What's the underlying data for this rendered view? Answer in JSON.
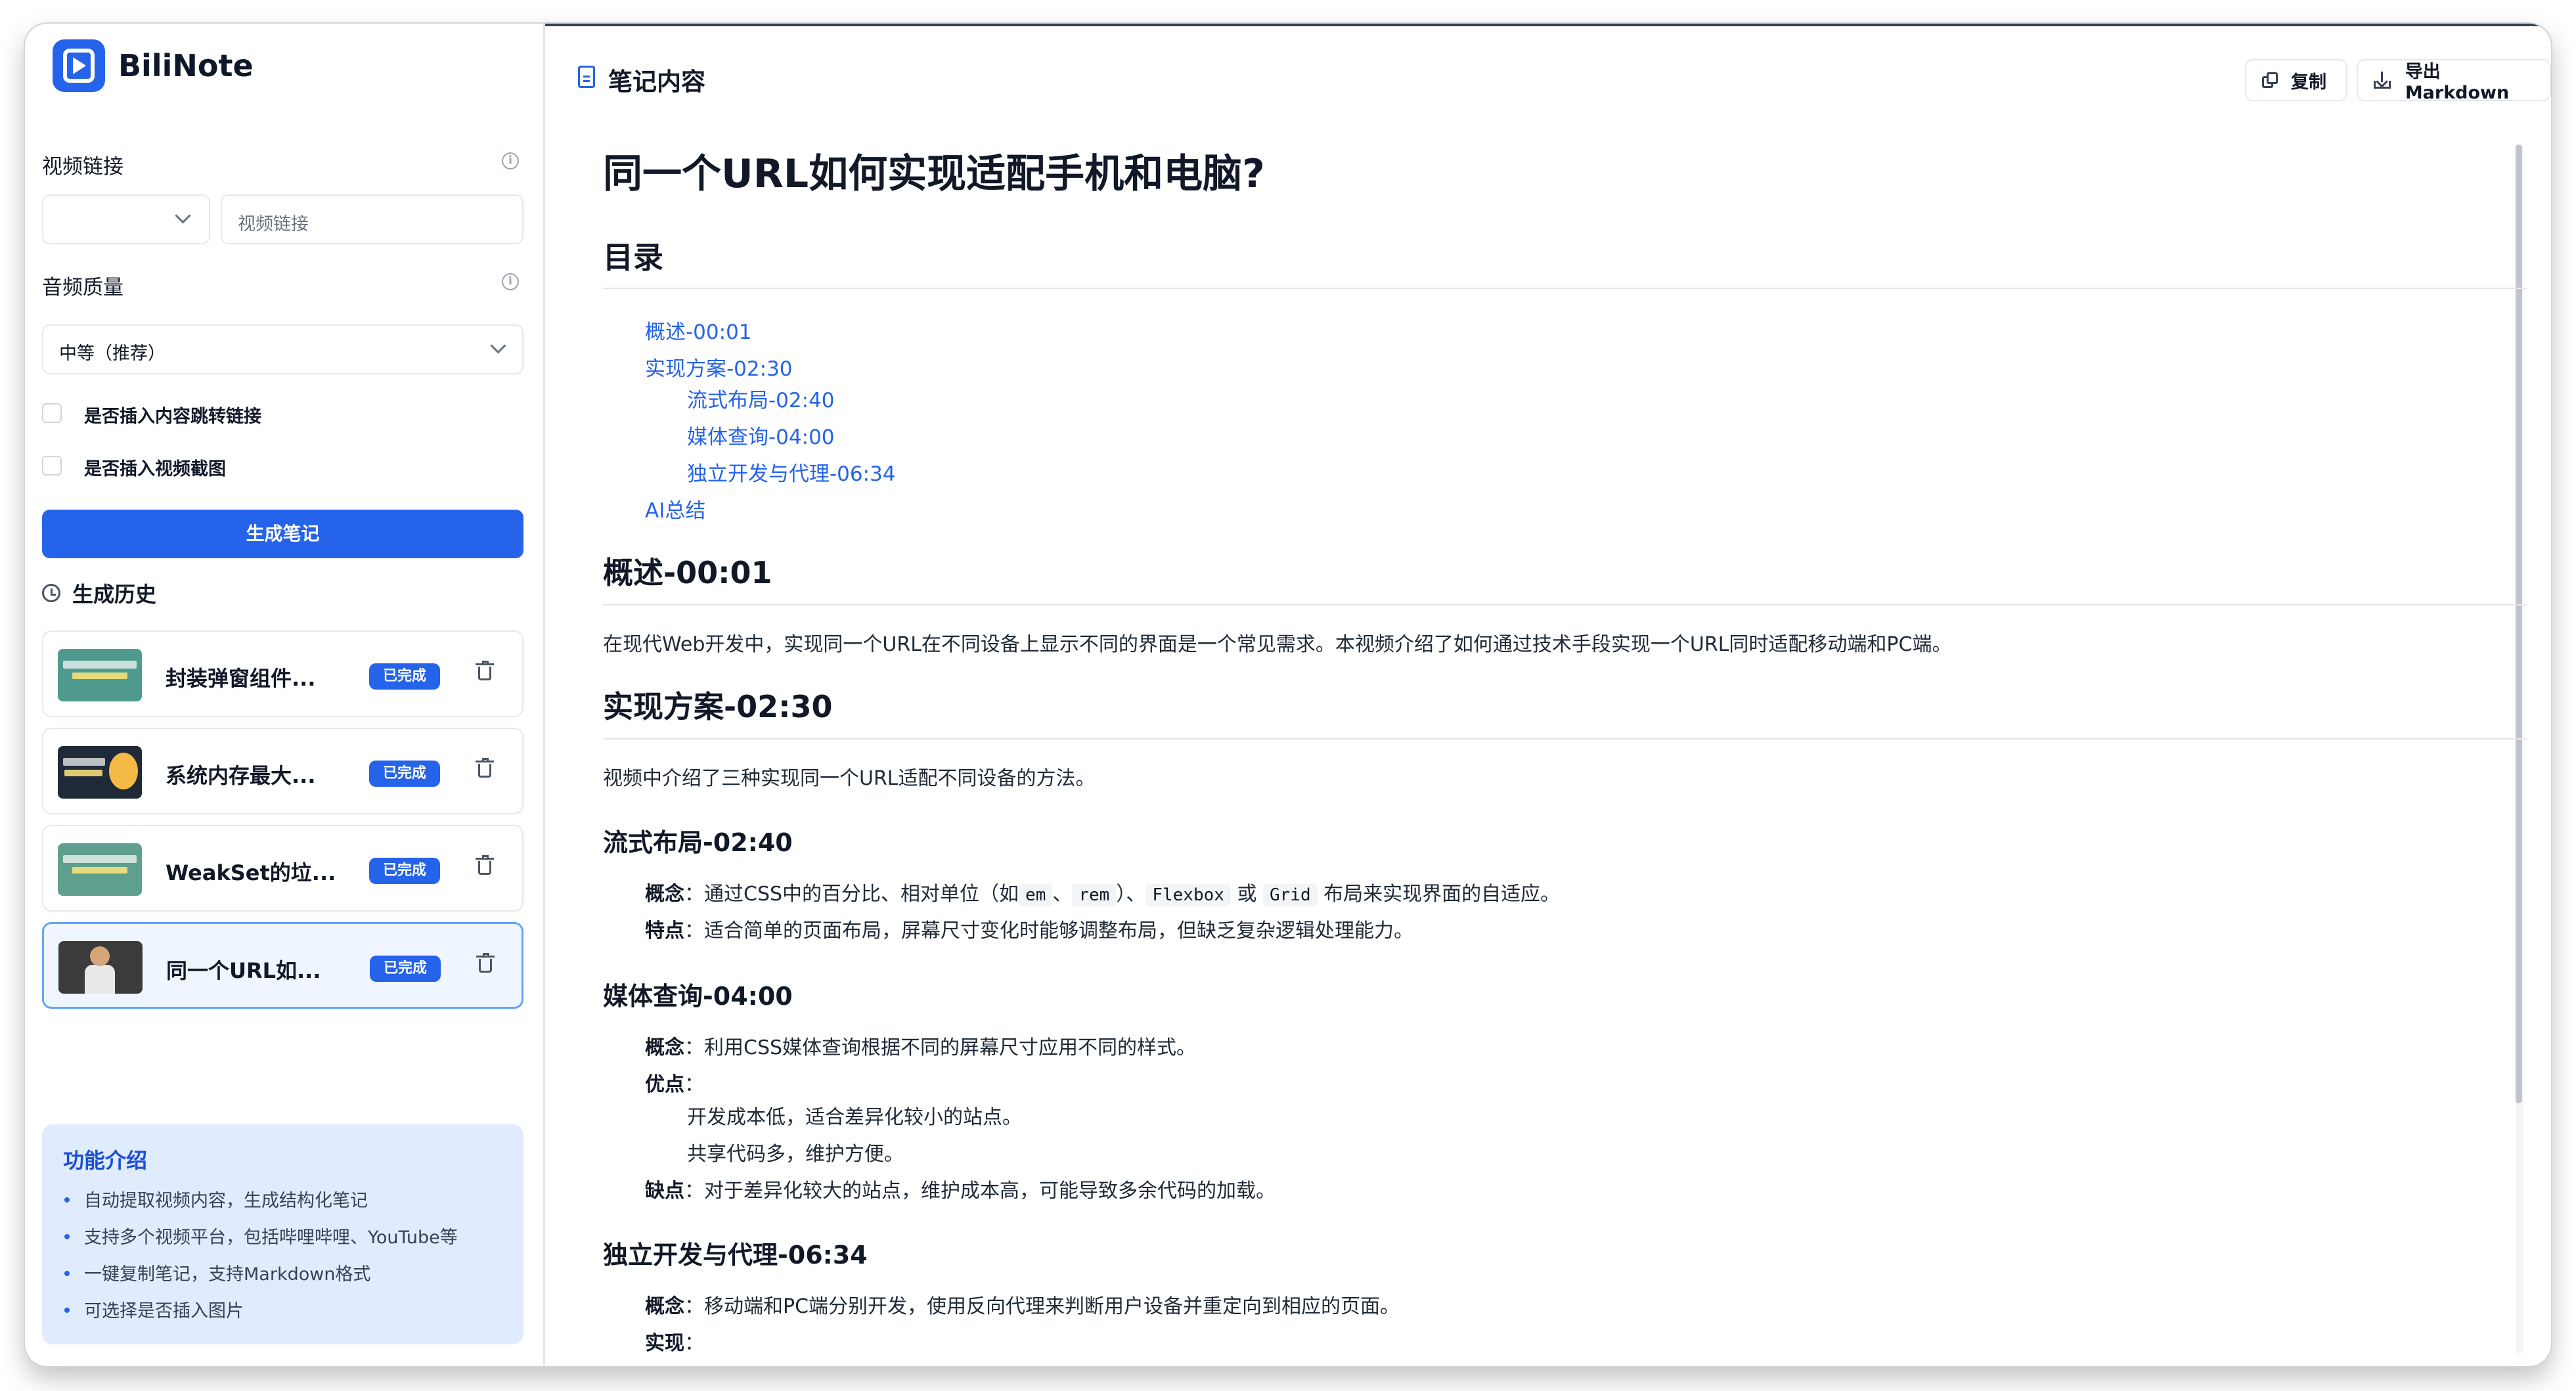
{
  "app": {
    "name": "BiliNote"
  },
  "sidebar": {
    "video_link_label": "视频链接",
    "platform_select_value": "",
    "video_link_placeholder": "视频链接",
    "audio_quality_label": "音频质量",
    "audio_quality_value": "中等（推荐）",
    "checkbox_link_label": "是否插入内容跳转链接",
    "checkbox_screenshot_label": "是否插入视频截图",
    "generate_button": "生成笔记",
    "history_title": "生成历史",
    "history": [
      {
        "title": "封装弹窗组件...",
        "status": "已完成",
        "thumb_color": "#4f9a8e"
      },
      {
        "title": "系统内存最大...",
        "status": "已完成",
        "thumb_color": "#1f2937"
      },
      {
        "title": "WeakSet的垃...",
        "status": "已完成",
        "thumb_color": "#5f9f8f"
      },
      {
        "title": "同一个URL如...",
        "status": "已完成",
        "thumb_color": "#3b3b3b",
        "active": true
      }
    ],
    "features": {
      "title": "功能介绍",
      "items": [
        "自动提取视频内容，生成结构化笔记",
        "支持多个视频平台，包括哔哩哔哩、YouTube等",
        "一键复制笔记，支持Markdown格式",
        "可选择是否插入图片"
      ]
    }
  },
  "main": {
    "header_title": "笔记内容",
    "copy_button": "复制",
    "export_button": "导出 Markdown",
    "doc_title": "同一个URL如何实现适配手机和电脑?",
    "toc_heading": "目录",
    "toc": [
      "概述-00:01",
      "实现方案-02:30",
      "流式布局-02:40",
      "媒体查询-04:00",
      "独立开发与代理-06:34",
      "AI总结"
    ],
    "overview_heading": "概述-00:01",
    "overview_text": "在现代Web开发中，实现同一个URL在不同设备上显示不同的界面是一个常见需求。本视频介绍了如何通过技术手段实现一个URL同时适配移动端和PC端。",
    "solution_heading": "实现方案-02:30",
    "solution_text": "视频中介绍了三种实现同一个URL适配不同设备的方法。",
    "fluid": {
      "heading": "流式布局-02:40",
      "concept_label": "概念",
      "concept_pre": "：通过CSS中的百分比、相对单位（如",
      "code_em": "em",
      "sep1": "、",
      "code_rem": "rem",
      "mid": "）、",
      "code_flexbox": "Flexbox",
      "or": "或",
      "code_grid": "Grid",
      "concept_post": "布局来实现界面的自适应。",
      "feature_label": "特点",
      "feature_text": "：适合简单的页面布局，屏幕尺寸变化时能够调整布局，但缺乏复杂逻辑处理能力。"
    },
    "media": {
      "heading": "媒体查询-04:00",
      "concept_label": "概念",
      "concept_text": "：利用CSS媒体查询根据不同的屏幕尺寸应用不同的样式。",
      "pros_label": "优点",
      "pros_colon": "：",
      "pros": [
        "开发成本低，适合差异化较小的站点。",
        "共享代码多，维护方便。"
      ],
      "cons_label": "缺点",
      "cons_text": "：对于差异化较大的站点，维护成本高，可能导致多余代码的加载。"
    },
    "independent": {
      "heading": "独立开发与代理-06:34",
      "concept_label": "概念",
      "concept_text": "：移动端和PC端分别开发，使用反向代理来判断用户设备并重定向到相应的页面。",
      "impl_label": "实现",
      "impl_colon": "："
    }
  }
}
